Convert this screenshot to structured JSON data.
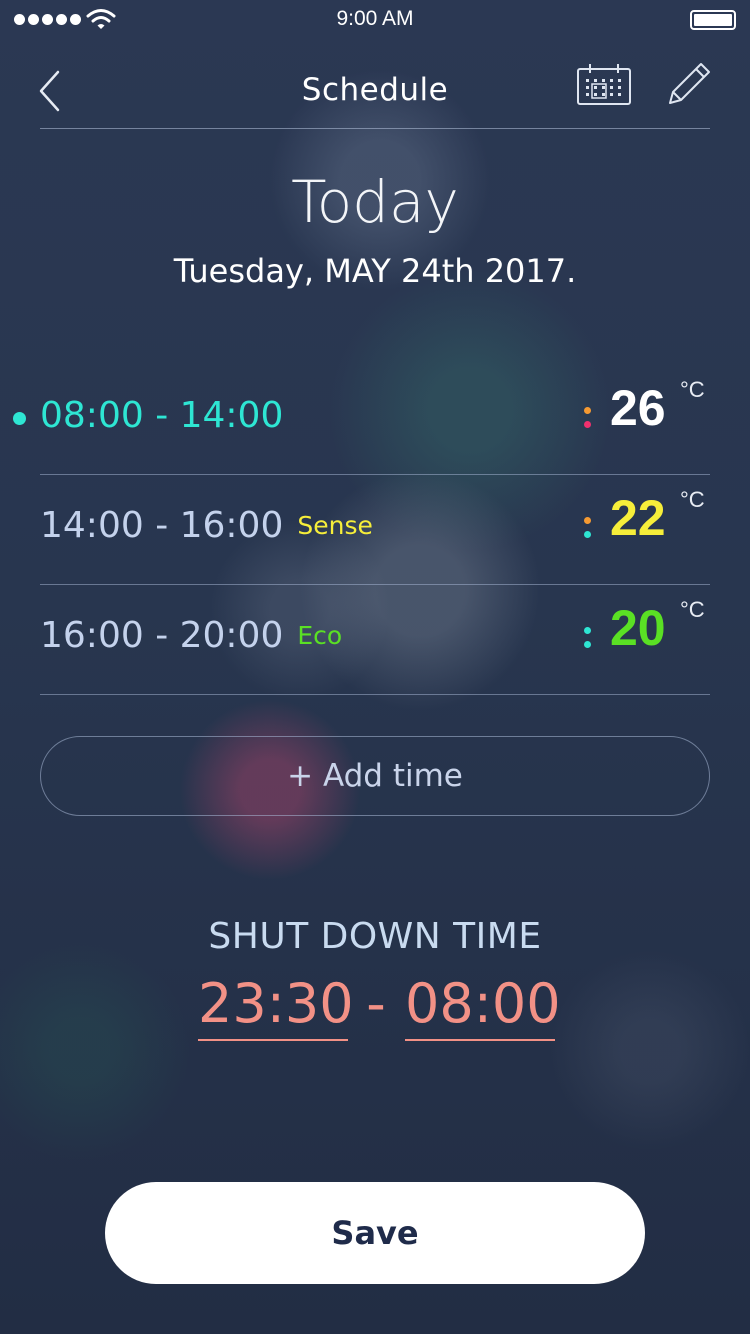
{
  "status_bar": {
    "time": "9:00 AM",
    "signal_bars": 5,
    "battery_level": 1.0,
    "signal_icon": "signal-dots-icon",
    "wifi_icon": "wifi-icon",
    "battery_icon": "battery-icon"
  },
  "nav": {
    "title": "Schedule",
    "back_icon": "chevron-left-icon",
    "calendar_icon": "calendar-icon",
    "edit_icon": "pencil-icon"
  },
  "day": {
    "title": "Today",
    "date": "Tuesday, MAY 24th 2017."
  },
  "schedule": [
    {
      "range": "08:00 - 14:00",
      "mode": "",
      "temp": "26",
      "unit": "°C",
      "active": true,
      "temp_color": "#ffffff",
      "dot_colors": [
        "#f59a32",
        "#f0306e"
      ]
    },
    {
      "range": "14:00 - 16:00",
      "mode": "Sense",
      "temp": "22",
      "unit": "°C",
      "active": false,
      "temp_color": "#f6ee3a",
      "dot_colors": [
        "#f59a32",
        "#2ee6d3"
      ]
    },
    {
      "range": "16:00 - 20:00",
      "mode": "Eco",
      "temp": "20",
      "unit": "°C",
      "active": false,
      "temp_color": "#5ae024",
      "dot_colors": [
        "#2ee6d3",
        "#2ee6d3"
      ]
    }
  ],
  "add_time_label": "+ Add time",
  "shutdown": {
    "label": "SHUT DOWN TIME",
    "start": "23:30",
    "separator": "-",
    "end": "08:00"
  },
  "save_label": "Save",
  "colors": {
    "accent_cyan": "#2ee6d3",
    "sense_yellow": "#f6ee3a",
    "eco_green": "#5ae024",
    "shutdown_salmon": "#f29186",
    "background": "#26334a"
  }
}
